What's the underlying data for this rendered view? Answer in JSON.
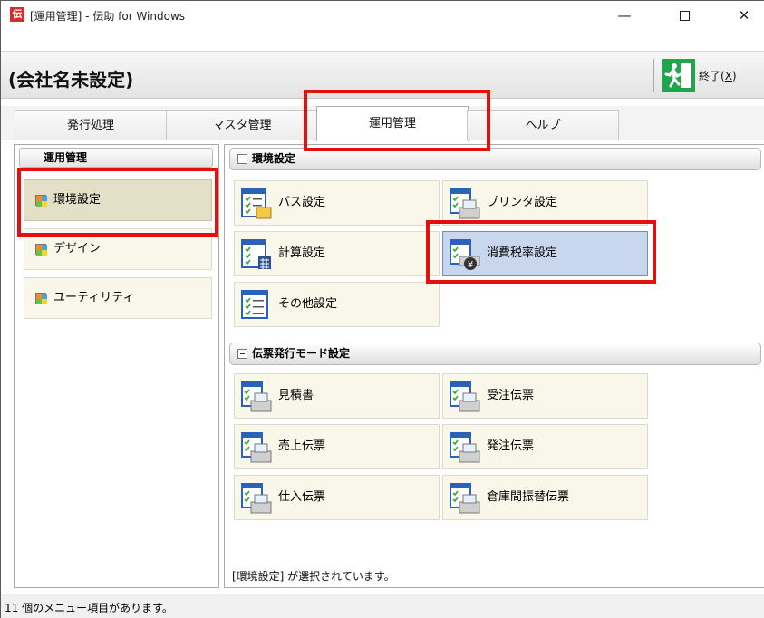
{
  "window": {
    "app_icon": "伝",
    "title": "[運用管理] - 伝助 for Windows",
    "minimize": "—",
    "close": "✕"
  },
  "company": {
    "name": "(会社名未設定)",
    "exit_label": "終了(",
    "exit_key": "X",
    "exit_close_paren": ")"
  },
  "tabs": [
    {
      "label": "発行処理"
    },
    {
      "label": "マスタ管理"
    },
    {
      "label": "運用管理"
    },
    {
      "label": "ヘルプ"
    }
  ],
  "sidebar": {
    "header": "運用管理",
    "items": [
      {
        "label": "環境設定"
      },
      {
        "label": "デザイン"
      },
      {
        "label": "ユーティリティ"
      }
    ]
  },
  "main": {
    "sections": [
      {
        "title": "環境設定",
        "items": [
          {
            "label": "パス設定"
          },
          {
            "label": "プリンタ設定"
          },
          {
            "label": "計算設定"
          },
          {
            "label": "消費税率設定"
          },
          {
            "label": "その他設定"
          }
        ]
      },
      {
        "title": "伝票発行モード設定",
        "items": [
          {
            "label": "見積書"
          },
          {
            "label": "受注伝票"
          },
          {
            "label": "売上伝票"
          },
          {
            "label": "発注伝票"
          },
          {
            "label": "仕入伝票"
          },
          {
            "label": "倉庫間振替伝票"
          }
        ]
      }
    ],
    "selection_status": "[環境設定] が選択されています。"
  },
  "statusbar": {
    "text": "11 個のメニュー項目があります。"
  },
  "colors": {
    "highlight": "#e3100e",
    "exit_icon": "#1ea64a",
    "selected_item": "#e4e0c8",
    "hover_item": "#c9d7ee"
  }
}
